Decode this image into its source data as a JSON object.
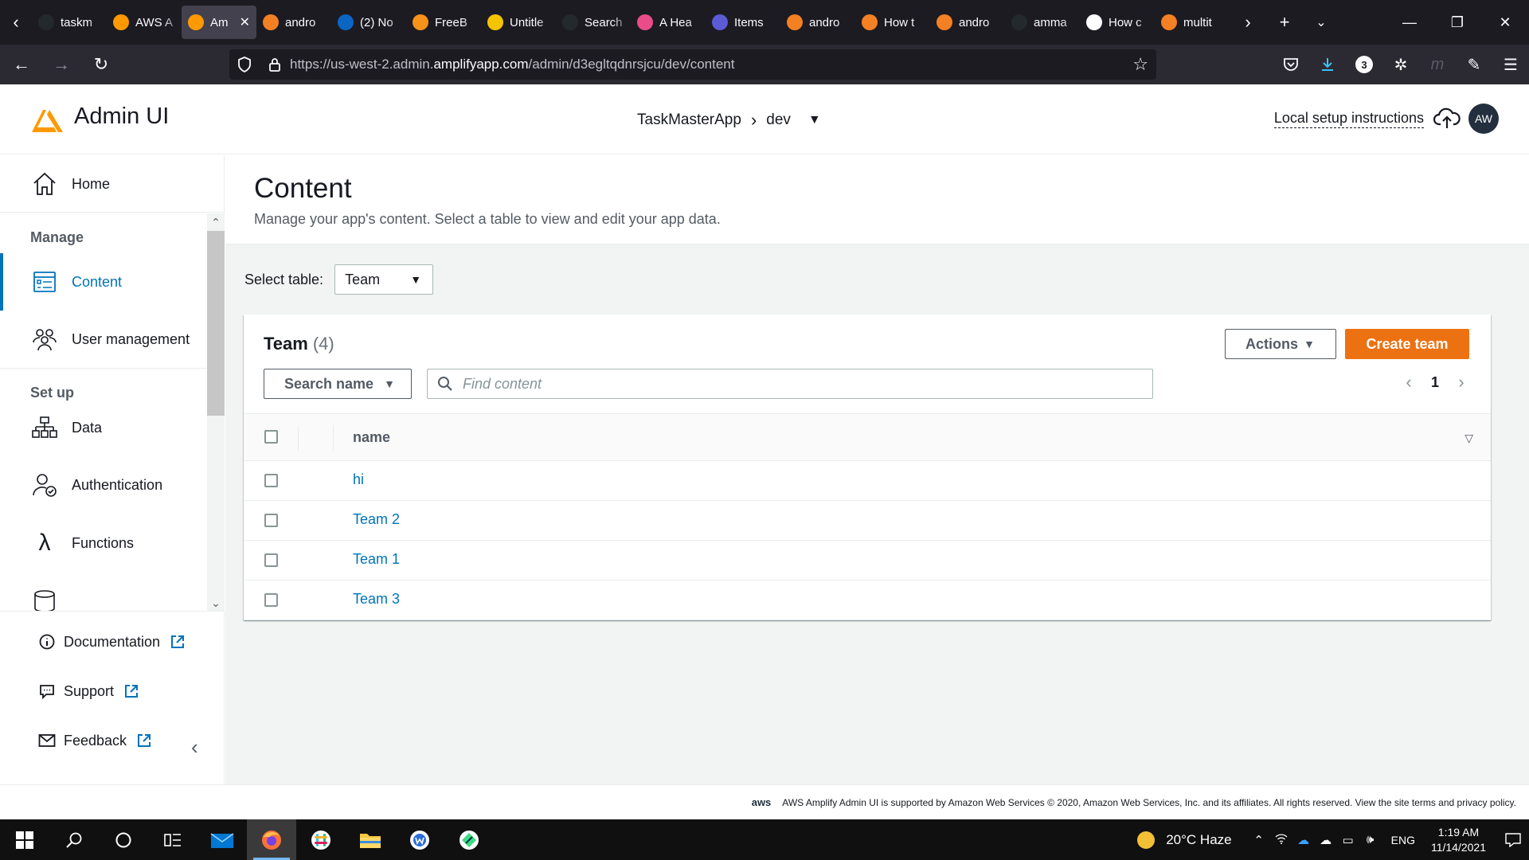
{
  "browser": {
    "tabs": [
      {
        "label": "taskm",
        "icon_color": "#24292e",
        "icon": "github-icon"
      },
      {
        "label": "AWS A",
        "icon_color": "#ff9900",
        "icon": "aws-box-icon"
      },
      {
        "label": "Am",
        "icon_color": "#ff9900",
        "icon": "amplify-icon",
        "active": true
      },
      {
        "label": "andro",
        "icon_color": "#f48024",
        "icon": "stackoverflow-icon"
      },
      {
        "label": "(2) No",
        "icon_color": "#0a66c2",
        "icon": "linkedin-icon"
      },
      {
        "label": "FreeB",
        "icon_color": "#f7931a",
        "icon": "bitcoin-icon"
      },
      {
        "label": "Untitle",
        "icon_color": "#f5c400",
        "icon": "miro-icon"
      },
      {
        "label": "Search",
        "icon_color": "#24292e",
        "icon": "github-icon"
      },
      {
        "label": "A Hea",
        "icon_color": "#ea4c89",
        "icon": "dribbble-icon"
      },
      {
        "label": "Items",
        "icon_color": "#5b5bd6",
        "icon": "items-icon"
      },
      {
        "label": "andro",
        "icon_color": "#f48024",
        "icon": "stackoverflow-icon"
      },
      {
        "label": "How t",
        "icon_color": "#f48024",
        "icon": "stackoverflow-icon"
      },
      {
        "label": "andro",
        "icon_color": "#f48024",
        "icon": "stackoverflow-icon"
      },
      {
        "label": "amma",
        "icon_color": "#24292e",
        "icon": "github-icon"
      },
      {
        "label": "How c",
        "icon_color": "#ffffff",
        "icon": "diamond-icon"
      },
      {
        "label": "multit",
        "icon_color": "#f48024",
        "icon": "stackoverflow-icon"
      }
    ],
    "url_prefix": "https://us-west-2.admin.",
    "url_host": "amplifyapp.com",
    "url_path": "/admin/d3egltqdnrsjcu/dev/content",
    "downloads_count": "3"
  },
  "header": {
    "app_title": "Admin UI",
    "breadcrumb_app": "TaskMasterApp",
    "breadcrumb_env": "dev",
    "setup_link": "Local setup instructions",
    "avatar_initials": "AW",
    "accent_color": "#ff9900"
  },
  "sidebar": {
    "home_label": "Home",
    "manage_heading": "Manage",
    "content_label": "Content",
    "user_mgmt_label": "User management",
    "setup_heading": "Set up",
    "data_label": "Data",
    "auth_label": "Authentication",
    "functions_label": "Functions",
    "documentation_label": "Documentation",
    "support_label": "Support",
    "feedback_label": "Feedback"
  },
  "main": {
    "title": "Content",
    "description": "Manage your app's content. Select a table to view and edit your app data.",
    "select_label": "Select table:",
    "select_value": "Team",
    "card_title": "Team",
    "card_count": "(4)",
    "actions_label": "Actions",
    "create_label": "Create team",
    "search_filter_label": "Search name",
    "search_placeholder": "Find content",
    "page_number": "1",
    "column_name": "name",
    "rows": [
      "hi",
      "Team 2",
      "Team 1",
      "Team 3"
    ],
    "primary_color": "#ec7211",
    "link_color": "#0073bb"
  },
  "footer": {
    "aws_label": "aws",
    "text": "AWS Amplify Admin UI is supported by Amazon Web Services © 2020, Amazon Web Services, Inc. and its affiliates. All rights reserved. View the site terms and privacy policy."
  },
  "taskbar": {
    "weather": "20°C  Haze",
    "language": "ENG",
    "time": "1:19 AM",
    "date": "11/14/2021"
  }
}
